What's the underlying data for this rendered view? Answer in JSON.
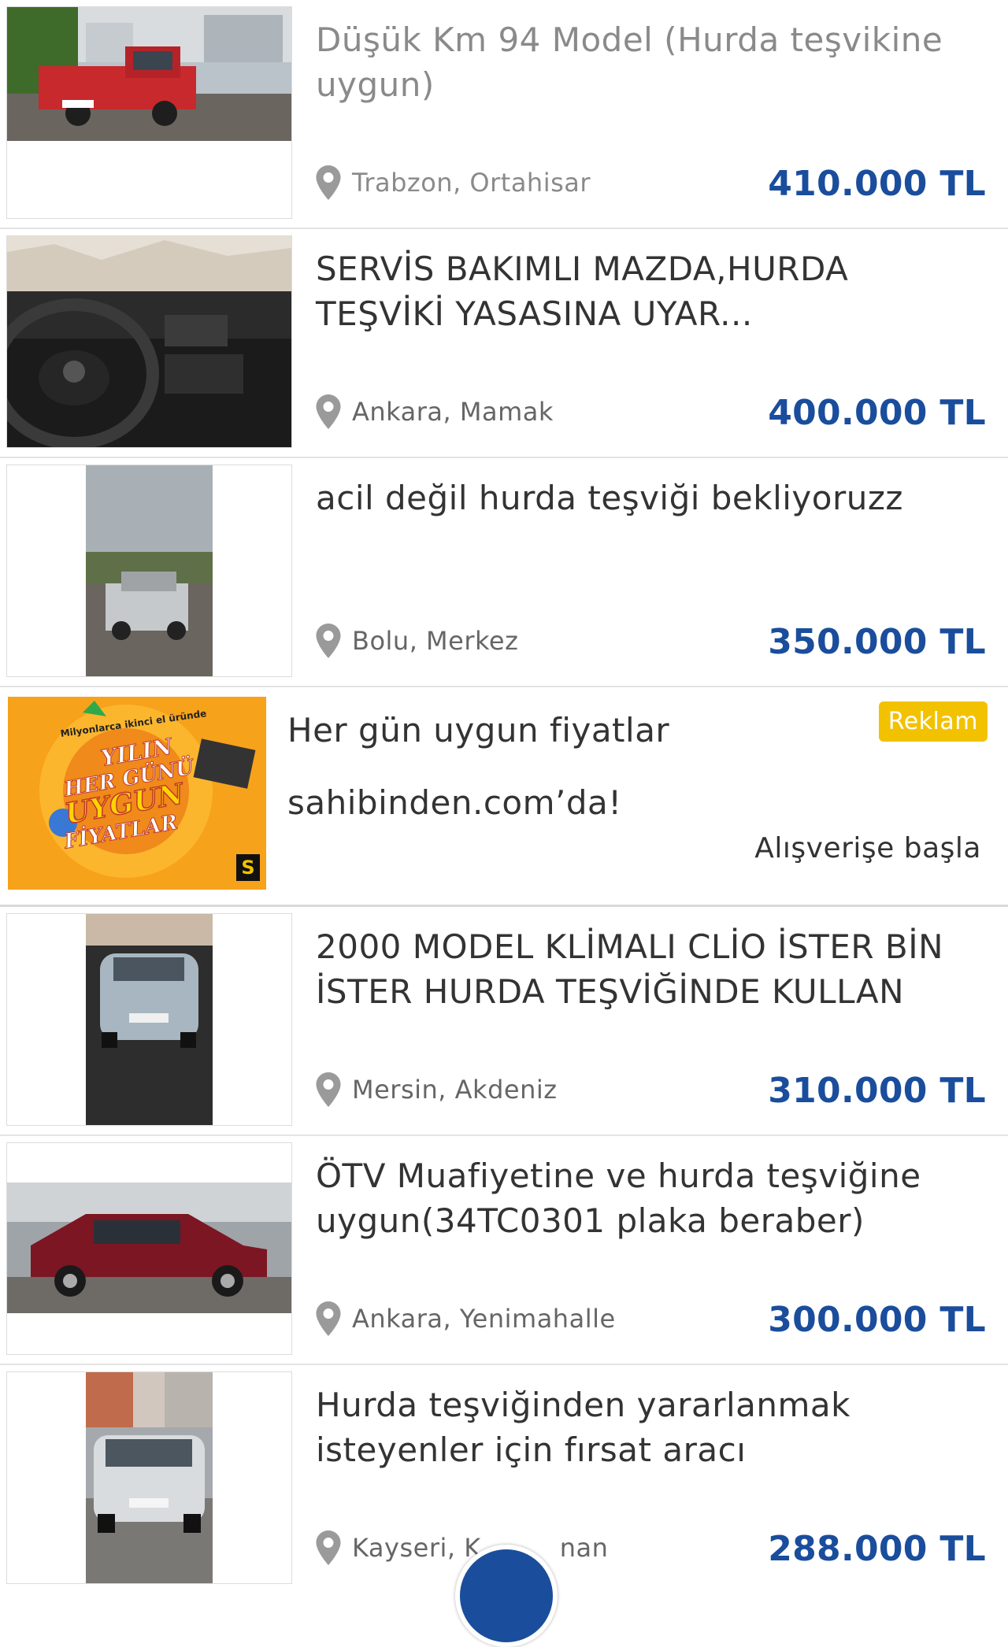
{
  "listings": [
    {
      "title": "Düşük Km 94 Model (Hurda teşvikine uygun)",
      "location": "Trabzon, Ortahisar",
      "price": "410.000 TL",
      "visited": true
    },
    {
      "title": "SERVİS BAKIMLI MAZDA,HURDA TEŞVİKİ YASASINA UYAR...",
      "location": "Ankara, Mamak",
      "price": "400.000 TL",
      "visited": false
    },
    {
      "title": "acil değil hurda teşviği bekliyoruzz",
      "location": "Bolu, Merkez",
      "price": "350.000 TL",
      "visited": false
    },
    {
      "title": "2000 MODEL KLİMALI CLİO İSTER BİN İSTER HURDA TEŞVİĞİNDE KULLAN",
      "location": "Mersin, Akdeniz",
      "price": "310.000 TL",
      "visited": false
    },
    {
      "title": "ÖTV Muafiyetine ve hurda teşviğine uygun(34TC0301 plaka beraber)",
      "location": "Ankara, Yenimahalle",
      "price": "300.000 TL",
      "visited": false
    },
    {
      "title": "Hurda teşviğinden yararlanmak isteyenler için fırsat aracı",
      "location": "Kayseri, K",
      "location_tail": "nan",
      "price": "288.000 TL",
      "visited": false
    }
  ],
  "ad": {
    "line1": "Her gün uygun fiyatlar",
    "line2": "sahibinden.com’da!",
    "badge": "Reklam",
    "cta": "Alışverişe başla",
    "banner": {
      "top_text": "Milyonlarca ikinci el üründe",
      "line_a": "YILIN",
      "line_b": "HER GÜNÜ",
      "line_c": "UYGUN",
      "line_d": "FİYATLAR",
      "logo": "S"
    }
  },
  "icons": {
    "location": "map-pin-icon"
  },
  "colors": {
    "price": "#1a4d9c",
    "badge": "#f2c200",
    "ad_bg": "#f7a21b"
  }
}
